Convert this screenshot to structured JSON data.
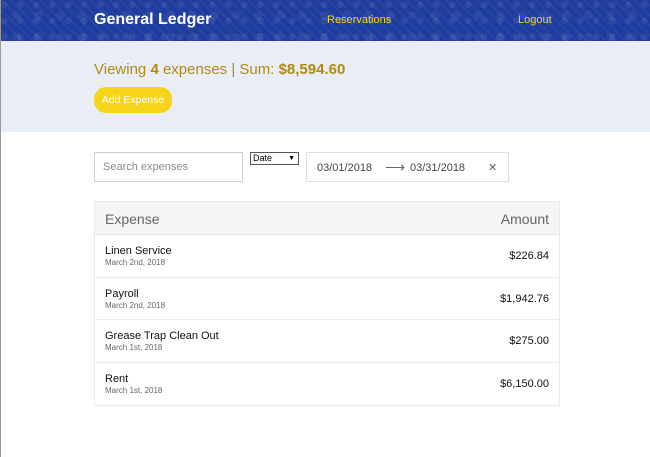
{
  "header": {
    "brand": "General Ledger",
    "nav": {
      "reservations": "Reservations",
      "logout": "Logout"
    }
  },
  "summary": {
    "viewing_prefix": "Viewing",
    "count": "4",
    "count_suffix": "expenses | Sum:",
    "sum": "$8,594.60",
    "add_button": "Add Expense"
  },
  "filters": {
    "search_placeholder": "Search expenses",
    "sort_select": "Date",
    "start_date": "03/01/2018",
    "end_date": "03/31/2018"
  },
  "table": {
    "headers": {
      "expense": "Expense",
      "amount": "Amount"
    },
    "rows": [
      {
        "name": "Linen Service",
        "date": "March 2nd, 2018",
        "amount": "$226.84"
      },
      {
        "name": "Payroll",
        "date": "March 2nd, 2018",
        "amount": "$1,942.76"
      },
      {
        "name": "Grease Trap Clean Out",
        "date": "March 1st, 2018",
        "amount": "$275.00"
      },
      {
        "name": "Rent",
        "date": "March 1st, 2018",
        "amount": "$6,150.00"
      }
    ]
  },
  "colors": {
    "header_bg": "#1e3c9e",
    "accent": "#f5d41a",
    "summary_text": "#b08a12",
    "summary_bg": "#e9edf5"
  },
  "icons": {
    "arrow": "arrow-right-icon",
    "clear": "close-icon",
    "caret": "caret-down-icon"
  }
}
